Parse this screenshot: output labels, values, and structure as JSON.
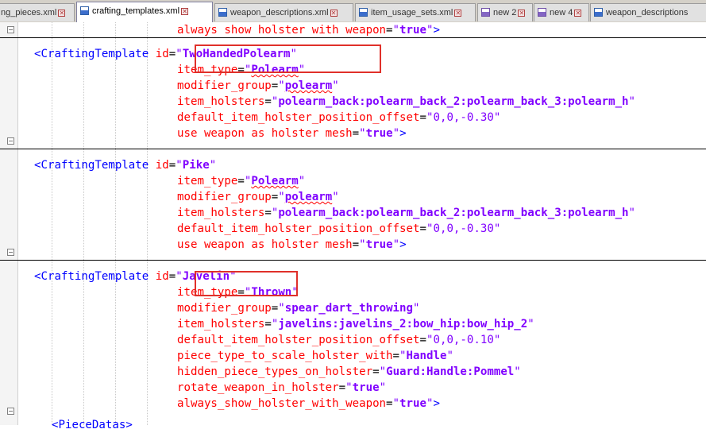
{
  "tabs": [
    {
      "label": "ng_pieces.xml",
      "icon": "save-icon",
      "active": false
    },
    {
      "label": "crafting_templates.xml",
      "icon": "save-icon",
      "active": true
    },
    {
      "label": "weapon_descriptions.xml",
      "icon": "save-icon",
      "active": false
    },
    {
      "label": "item_usage_sets.xml",
      "icon": "save-icon",
      "active": false
    },
    {
      "label": "new 2",
      "icon": "unsaved-icon",
      "active": false
    },
    {
      "label": "new 4",
      "icon": "unsaved-icon",
      "active": false
    },
    {
      "label": "weapon_descriptions",
      "icon": "save-icon",
      "active": false
    }
  ],
  "close_glyph": "✕",
  "quote": "\"",
  "equals": "=",
  "close_tag": ">",
  "editor": {
    "top_line": {
      "attr": "always show holster with weapon",
      "value": "true"
    },
    "templates": [
      {
        "open": "<CraftingTemplate",
        "id_attr": "id",
        "id": "TwoHandedPolearm",
        "lines": [
          {
            "attr": "item_type",
            "value": "Polearm",
            "squig": true
          },
          {
            "attr": "modifier_group",
            "value": "polearm",
            "squig": true
          },
          {
            "attr": "item_holsters",
            "value": "polearm_back:polearm_back_2:polearm_back_3:polearm_h"
          },
          {
            "attr": "default_item_holster_position_offset",
            "value": "0,0,-0.30",
            "plain": true
          },
          {
            "attr": "use weapon as holster mesh",
            "value": "true",
            "close": true
          }
        ]
      },
      {
        "open": "<CraftingTemplate",
        "id_attr": "id",
        "id": "Pike",
        "lines": [
          {
            "attr": "item_type",
            "value": "Polearm",
            "squig": true
          },
          {
            "attr": "modifier_group",
            "value": "polearm",
            "squig": true
          },
          {
            "attr": "item_holsters",
            "value": "polearm_back:polearm_back_2:polearm_back_3:polearm_h"
          },
          {
            "attr": "default_item_holster_position_offset",
            "value": "0,0,-0.30",
            "plain": true
          },
          {
            "attr": "use weapon as holster mesh",
            "value": "true",
            "close": true
          }
        ]
      },
      {
        "open": "<CraftingTemplate",
        "id_attr": "id",
        "id": "Javelin",
        "lines": [
          {
            "attr": "item_type",
            "value": "Thrown"
          },
          {
            "attr": "modifier_group",
            "value": "spear_dart_throwing"
          },
          {
            "attr": "item_holsters",
            "value": "javelins:javelins_2:bow_hip:bow_hip_2"
          },
          {
            "attr": "default_item_holster_position_offset",
            "value": "0,0,-0.10",
            "plain": true
          },
          {
            "attr": "piece_type_to_scale_holster_with",
            "value": "Handle"
          },
          {
            "attr": "hidden_piece_types_on_holster",
            "value": "Guard:Handle:Pommel"
          },
          {
            "attr": "rotate_weapon_in_holster",
            "value": "true"
          },
          {
            "attr": "always_show_holster_with_weapon",
            "value": "true",
            "close": true
          }
        ]
      }
    ],
    "bottom_partial": "<PieceDatas>"
  }
}
